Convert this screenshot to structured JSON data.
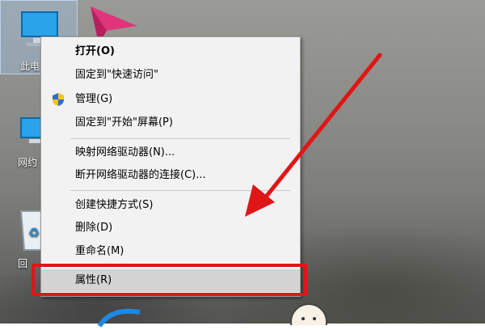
{
  "desktop": {
    "icons": [
      {
        "label": "此电"
      },
      {
        "label": "网约"
      },
      {
        "label": "回"
      }
    ]
  },
  "context_menu": {
    "items": [
      {
        "label": "打开(O)",
        "bold": true
      },
      {
        "label": "固定到\"快速访问\""
      },
      {
        "label": "管理(G)",
        "icon": "uac-shield-icon"
      },
      {
        "label": "固定到\"开始\"屏幕(P)"
      },
      {
        "label": "映射网络驱动器(N)..."
      },
      {
        "label": "断开网络驱动器的连接(C)..."
      },
      {
        "label": "创建快捷方式(S)"
      },
      {
        "label": "删除(D)"
      },
      {
        "label": "重命名(M)"
      },
      {
        "label": "属性(R)",
        "highlighted": true
      }
    ]
  },
  "annotation": {
    "highlight_color": "#e01616",
    "arrow_color": "#e01616"
  }
}
